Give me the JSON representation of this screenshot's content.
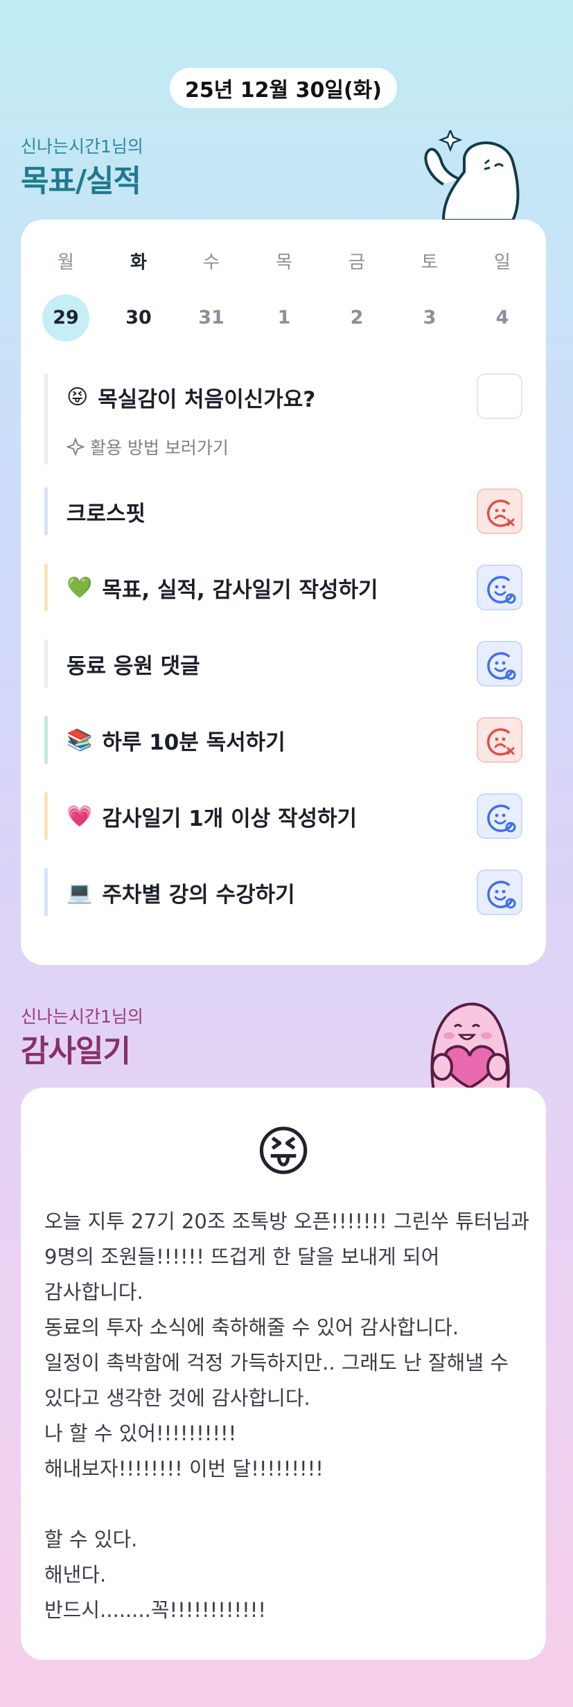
{
  "date_pill": "25년 12월 30일(화)",
  "goals_section": {
    "subtitle": "신나는시간1님의",
    "title": "목표/실적"
  },
  "calendar": {
    "days": [
      {
        "name": "월",
        "num": "29",
        "selected": true,
        "current": false
      },
      {
        "name": "화",
        "num": "30",
        "selected": false,
        "current": true
      },
      {
        "name": "수",
        "num": "31",
        "selected": false,
        "current": false
      },
      {
        "name": "목",
        "num": "1",
        "selected": false,
        "current": false
      },
      {
        "name": "금",
        "num": "2",
        "selected": false,
        "current": false
      },
      {
        "name": "토",
        "num": "3",
        "selected": false,
        "current": false
      },
      {
        "name": "일",
        "num": "4",
        "selected": false,
        "current": false
      }
    ]
  },
  "intro_item": {
    "emoji": "😝",
    "label": "목실감이 처음이신가요?",
    "guide_link": "활용 방법 보러가기"
  },
  "goals": [
    {
      "emoji": "",
      "label": "크로스핏",
      "status": "fail",
      "bar_color": "#d8e2fb"
    },
    {
      "emoji": "💚",
      "label": "목표, 실적, 감사일기 작성하기",
      "status": "ok",
      "bar_color": "#fbe4b4"
    },
    {
      "emoji": "",
      "label": "동료 응원 댓글",
      "status": "ok",
      "bar_color": "#ececef"
    },
    {
      "emoji": "📚",
      "label": "하루 10분 독서하기",
      "status": "fail",
      "bar_color": "#bfe9dc"
    },
    {
      "emoji": "💗",
      "label": "감사일기 1개 이상 작성하기",
      "status": "ok",
      "bar_color": "#fbe4b4"
    },
    {
      "emoji": "💻",
      "label": "주차별 강의 수강하기",
      "status": "ok",
      "bar_color": "#d8e2fb"
    }
  ],
  "diary_section": {
    "subtitle": "신나는시간1님의",
    "title": "감사일기"
  },
  "diary": {
    "mood_emoji": "😝",
    "text": "오늘 지투 27기 20조 조톡방 오픈!!!!!!! 그린쑤 튜터님과 9명의 조원들!!!!!! 뜨겁게 한 달을 보내게 되어 감사합니다.\n동료의 투자 소식에 축하해줄 수 있어 감사합니다.\n일정이 촉박함에 걱정 가득하지만.. 그래도 난 잘해낼 수 있다고 생각한 것에 감사합니다.\n나 할 수 있어!!!!!!!!!!\n해내보자!!!!!!!! 이번 달!!!!!!!!!\n\n할 수 있다.\n해낸다.\n반드시........꼭!!!!!!!!!!!!"
  },
  "colors": {
    "goals_title": "#1e7b8e",
    "diary_title": "#8a2f68",
    "ok_icon": "#3a6ff0",
    "fail_icon": "#e04e45",
    "selected_day_bg": "#c6eef6"
  }
}
